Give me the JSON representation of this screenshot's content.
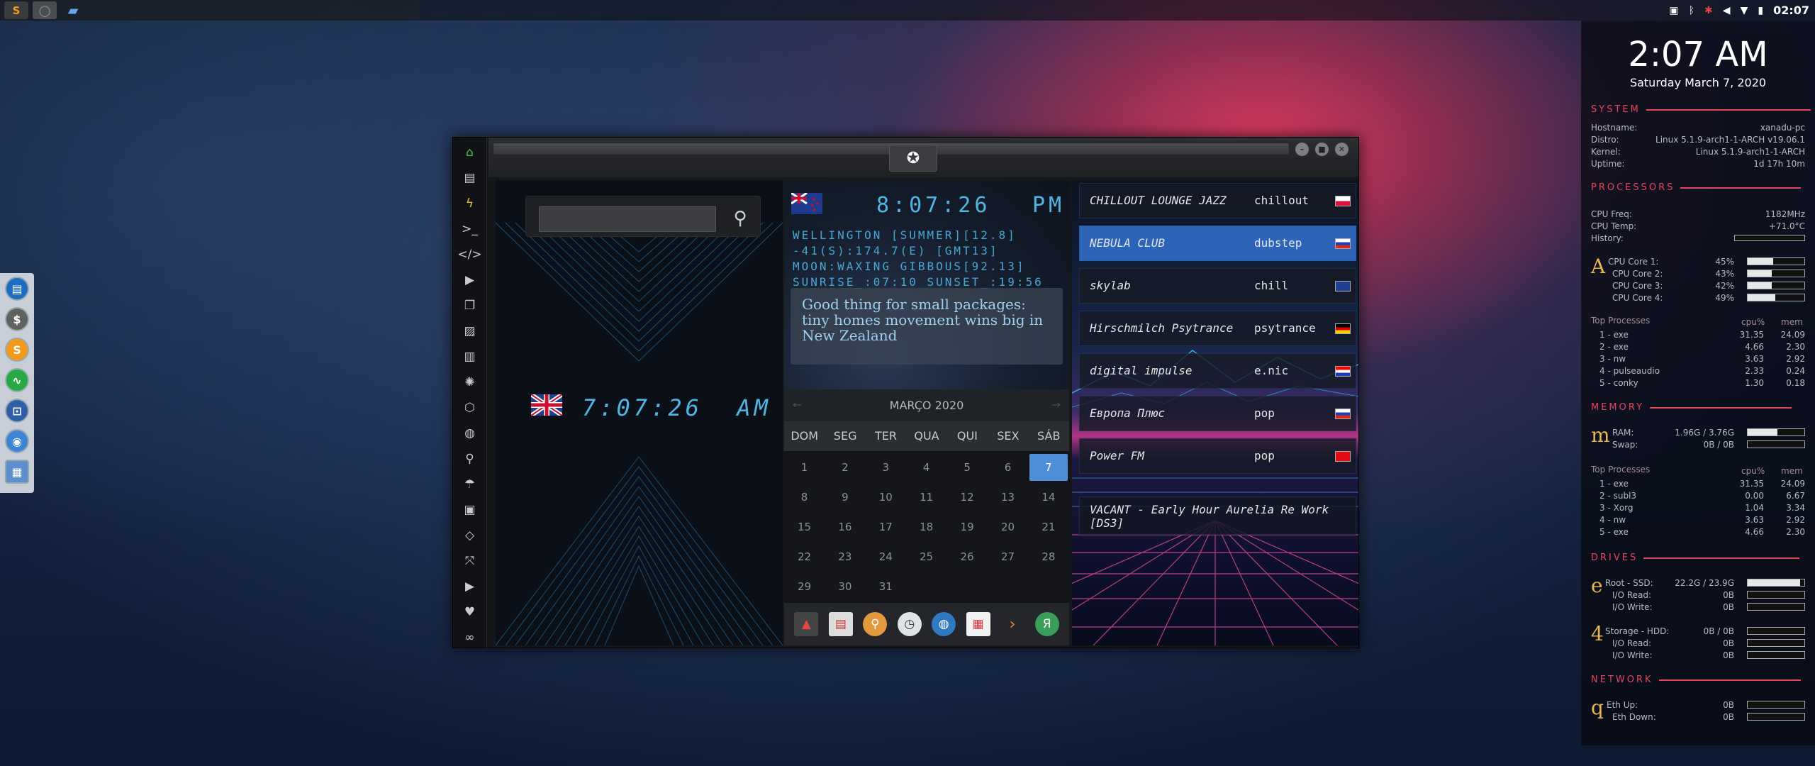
{
  "taskbar": {
    "apps": [
      "sublime-text-icon",
      "app-icon",
      "folder-icon"
    ],
    "clock": "02:07"
  },
  "left_dock": {
    "items": [
      "files-icon",
      "dollar-icon",
      "sublime-icon",
      "monitor-icon",
      "window-icon",
      "chrome-icon",
      "network-icon"
    ]
  },
  "window": {
    "sidebar": [
      "home-icon",
      "document-icon",
      "bolt-icon",
      "terminal-icon",
      "code-icon",
      "play-icon",
      "copy-icon",
      "image-icon",
      "news-icon",
      "settings-icon",
      "hexagon-icon",
      "globe-icon",
      "search-icon",
      "umbrella-icon",
      "contacts-icon",
      "tag-icon",
      "expand-icon",
      "youtube-icon",
      "heart-icon",
      "link-icon"
    ],
    "uk_clock": {
      "time": "7:07:26",
      "ampm": "AM"
    },
    "nz_clock": {
      "time": "8:07:26",
      "ampm": "PM",
      "line1": "WELLINGTON [SUMMER][12.8]",
      "line2": "-41(S):174.7(E) [GMT13]",
      "line3": "MOON:WAXING GIBBOUS[92.13]",
      "line4": "SUNRISE_:07:10 SUNSET_:19:56"
    },
    "news": "Good thing for small packages: tiny homes movement wins big in New Zealand",
    "calendar": {
      "month": "MARÇO 2020",
      "days": [
        "DOM",
        "SEG",
        "TER",
        "QUA",
        "QUI",
        "SEX",
        "SÁB"
      ],
      "dates": [
        "1",
        "2",
        "3",
        "4",
        "5",
        "6",
        "7",
        "8",
        "9",
        "10",
        "11",
        "12",
        "13",
        "14",
        "15",
        "16",
        "17",
        "18",
        "19",
        "20",
        "21",
        "22",
        "23",
        "24",
        "25",
        "26",
        "27",
        "28",
        "29",
        "30",
        "31"
      ],
      "today": "7"
    },
    "radio": [
      {
        "name": "CHILLOUT LOUNGE JAZZ",
        "genre": "chillout",
        "flag": "pl"
      },
      {
        "name": "NEBULA CLUB",
        "genre": "dubstep",
        "flag": "ru"
      },
      {
        "name": "skylab",
        "genre": "chill",
        "flag": "uk"
      },
      {
        "name": "Hirschmilch Psytrance",
        "genre": "psytrance",
        "flag": "de"
      },
      {
        "name": "digital impulse",
        "genre": "e.nic",
        "flag": "hr"
      },
      {
        "name": "Европа Плюс",
        "genre": "pop",
        "flag": "ru"
      },
      {
        "name": "Power FM",
        "genre": "pop",
        "flag": "tr"
      }
    ],
    "now_playing": "VACANT - Early Hour Aurelia Re Work [DS3]"
  },
  "conky": {
    "time": "2:07 AM",
    "date": "Saturday March  7, 2020",
    "system": {
      "title": "SYSTEM",
      "hostname_label": "Hostname:",
      "hostname": "xanadu-pc",
      "distro_label": "Distro:",
      "distro": "Linux 5.1.9-arch1-1-ARCH v19.06.1",
      "kernel_label": "Kernel:",
      "kernel": "Linux 5.1.9-arch1-1-ARCH",
      "uptime_label": "Uptime:",
      "uptime": "1d 17h 10m"
    },
    "processors": {
      "title": "PROCESSORS",
      "freq_label": "CPU Freq:",
      "freq": "1182MHz",
      "temp_label": "CPU Temp:",
      "temp": "+71.0°C",
      "history_label": "History:",
      "glyph": "A",
      "cores": [
        {
          "label": "CPU Core 1:",
          "value": "45%",
          "pct": 45
        },
        {
          "label": "CPU Core 2:",
          "value": "43%",
          "pct": 43
        },
        {
          "label": "CPU Core 3:",
          "value": "42%",
          "pct": 42
        },
        {
          "label": "CPU Core 4:",
          "value": "49%",
          "pct": 49
        }
      ],
      "top_label": "Top Processes",
      "cpu_h": "cpu%",
      "mem_h": "mem",
      "top": [
        [
          "1 - exe",
          "31.35",
          "24.09"
        ],
        [
          "2 - exe",
          "4.66",
          "2.30"
        ],
        [
          "3 - nw",
          "3.63",
          "2.92"
        ],
        [
          "4 - pulseaudio",
          "2.33",
          "0.24"
        ],
        [
          "5 - conky",
          "1.30",
          "0.18"
        ]
      ]
    },
    "memory": {
      "title": "MEMORY",
      "glyph": "m",
      "ram_label": "RAM:",
      "ram": "1.96G / 3.76G",
      "ram_pct": 52,
      "swap_label": "Swap:",
      "swap": "0B / 0B",
      "swap_pct": 0,
      "top_label": "Top Processes",
      "cpu_h": "cpu%",
      "mem_h": "mem",
      "top": [
        [
          "1 - exe",
          "31.35",
          "24.09"
        ],
        [
          "2 - subl3",
          "0.00",
          "6.67"
        ],
        [
          "3 - Xorg",
          "1.04",
          "3.34"
        ],
        [
          "4 - nw",
          "3.63",
          "2.92"
        ],
        [
          "5 - exe",
          "4.66",
          "2.30"
        ]
      ]
    },
    "drives": {
      "title": "DRIVES",
      "root_glyph": "e",
      "root_label": "Root - SSD:",
      "root": "22.2G / 23.9G",
      "root_pct": 93,
      "io_read": "I/O Read:",
      "io_write": "I/O Write:",
      "root_read": "0B",
      "root_write": "0B",
      "storage_glyph": "4",
      "storage_label": "Storage - HDD:",
      "storage": "0B / 0B",
      "storage_read": "0B",
      "storage_write": "0B"
    },
    "network": {
      "title": "NETWORK",
      "glyph": "q",
      "up_label": "Eth Up:",
      "up": "0B",
      "down_label": "Eth Down:",
      "down": "0B"
    }
  }
}
